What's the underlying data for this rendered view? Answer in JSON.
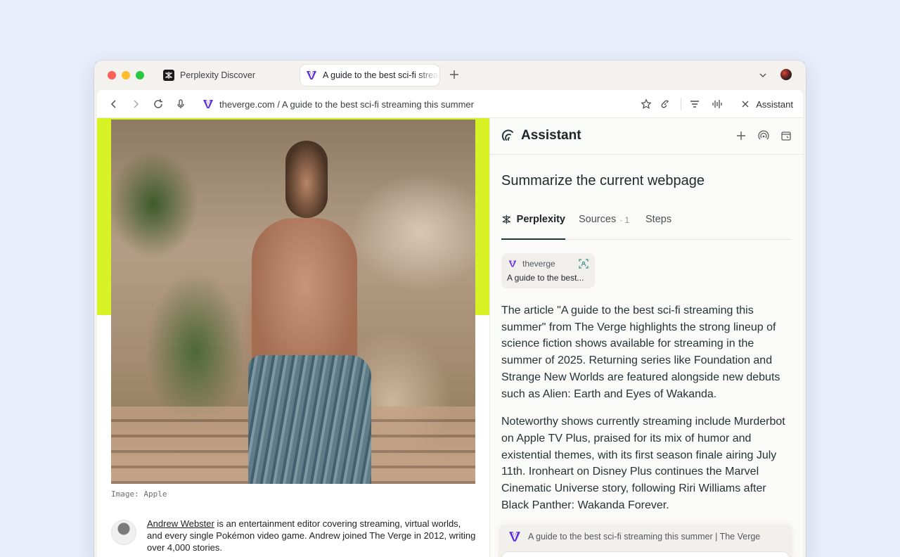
{
  "tabs": [
    {
      "title": "Perplexity Discover",
      "icon": "perplexity-icon"
    },
    {
      "title": "A guide to the best sci-fi streaming this summer",
      "icon": "verge-icon",
      "active": true
    }
  ],
  "toolbar": {
    "url": "theverge.com / A guide to the best sci-fi streaming this summer",
    "assistant_label": "Assistant"
  },
  "article": {
    "image_caption": "Image: Apple",
    "author_name": "Andrew Webster",
    "author_bio": " is an entertainment editor covering streaming, virtual worlds, and every single Pokémon video game. Andrew joined The Verge in 2012, writing over 4,000 stories."
  },
  "assistant": {
    "title": "Assistant",
    "question": "Summarize the current webpage",
    "tabs": [
      {
        "label": "Perplexity",
        "active": true
      },
      {
        "label": "Sources",
        "count": "· 1"
      },
      {
        "label": "Steps"
      }
    ],
    "source": {
      "site": "theverge",
      "title": "A guide to the best..."
    },
    "paragraphs": [
      "The article \"A guide to the best sci-fi streaming this summer\" from The Verge highlights the strong lineup of science fiction shows available for streaming in the summer of 2025. Returning series like Foundation and Strange New Worlds are featured alongside new debuts such as Alien: Earth and Eyes of Wakanda.",
      "Noteworthy shows currently streaming include Murderbot on Apple TV Plus, praised for its mix of humor and existential themes, with its first season finale airing July 11th. Ironheart on Disney Plus continues the Marvel Cinematic Universe story, following Riri Williams after Black Panther: Wakanda Forever."
    ],
    "context_card_title": "A guide to the best sci-fi streaming this summer | The Verge"
  },
  "colors": {
    "accent_lime": "#d7f325",
    "verge_purple": "#5b2bd9",
    "active_tab_underline": "#20363f"
  }
}
